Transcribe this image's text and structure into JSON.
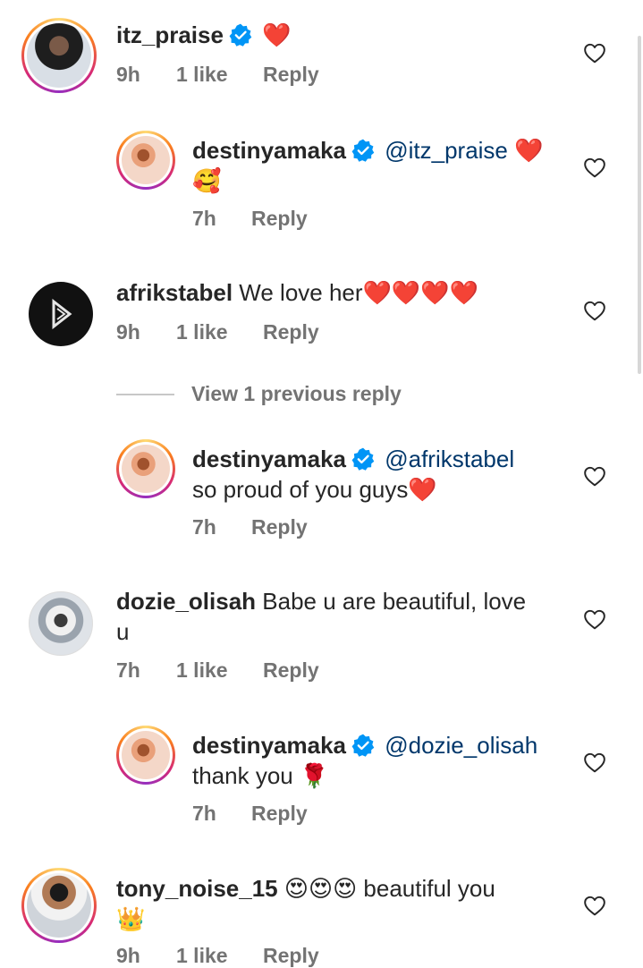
{
  "actions": {
    "reply_label": "Reply"
  },
  "comments": [
    {
      "username": "itz_praise",
      "text": "❤️",
      "time": "9h",
      "likes": "1 like",
      "verified": true
    },
    {
      "username": "destinyamaka",
      "mention": "@itz_praise",
      "text": " ❤️",
      "text2": "🥰",
      "time": "7h",
      "verified": true
    },
    {
      "username": "afrikstabel",
      "text": " We love her❤️❤️❤️❤️",
      "time": "9h",
      "likes": "1 like"
    },
    {
      "username": "destinyamaka",
      "mention": "@afrikstabel",
      "text2": "so proud of you guys❤️",
      "time": "7h",
      "verified": true
    },
    {
      "username": "dozie_olisah",
      "text": " Babe u are beautiful, love",
      "text2": "u",
      "time": "7h",
      "likes": "1 like"
    },
    {
      "username": "destinyamaka",
      "mention": "@dozie_olisah",
      "text2": "thank you 🌹",
      "time": "7h",
      "verified": true
    },
    {
      "username": "tony_noise_15",
      "text": " 😍😍😍 beautiful you",
      "text2": "👑",
      "time": "9h",
      "likes": "1 like"
    }
  ],
  "view_previous": "View 1 previous reply",
  "colors": {
    "verified": "#0095f6",
    "mention": "#00376b",
    "meta": "#737373"
  }
}
